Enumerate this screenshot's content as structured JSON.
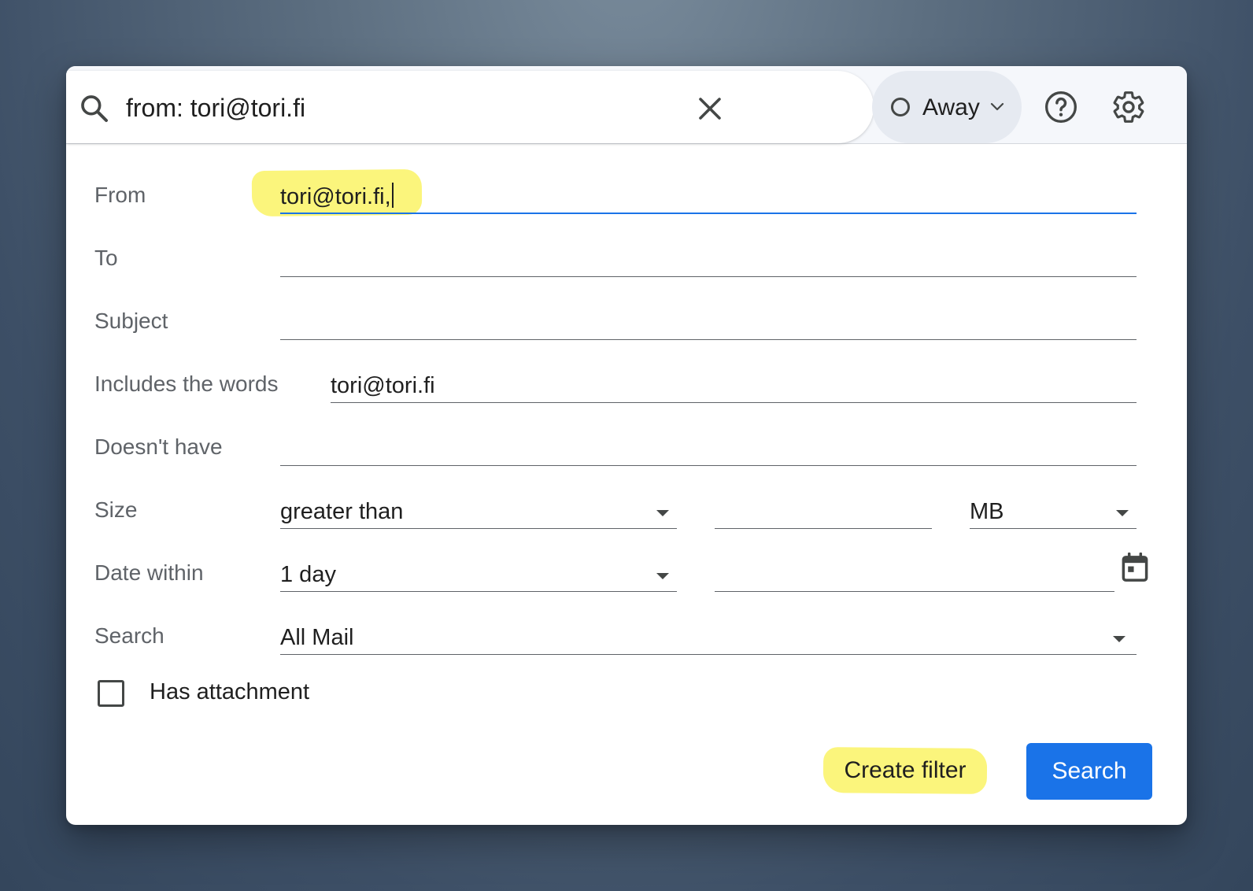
{
  "search": {
    "query": "from: tori@tori.fi"
  },
  "status": {
    "label": "Away"
  },
  "form": {
    "from": {
      "label": "From",
      "value": "tori@tori.fi,"
    },
    "to": {
      "label": "To",
      "value": ""
    },
    "subject": {
      "label": "Subject",
      "value": ""
    },
    "includes": {
      "label": "Includes the words",
      "value": "tori@tori.fi"
    },
    "doesnt_have": {
      "label": "Doesn't have",
      "value": ""
    },
    "size": {
      "label": "Size",
      "operator": "greater than",
      "amount": "",
      "unit": "MB"
    },
    "date_within": {
      "label": "Date within",
      "range": "1 day",
      "date": ""
    },
    "search_in": {
      "label": "Search",
      "value": "All Mail"
    },
    "has_attachment": {
      "label": "Has attachment",
      "checked": false
    }
  },
  "actions": {
    "create_filter": "Create filter",
    "search": "Search"
  },
  "colors": {
    "accent": "#1a73e8",
    "highlight": "#fbf57c"
  },
  "icons": [
    "search-icon",
    "close-icon",
    "status-circle-icon",
    "chevron-down-icon",
    "help-icon",
    "gear-icon",
    "dropdown-arrow-icon",
    "calendar-icon"
  ]
}
